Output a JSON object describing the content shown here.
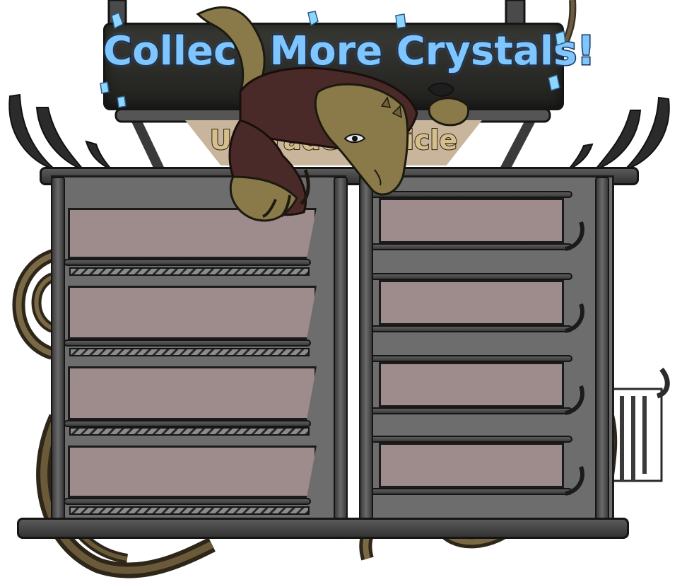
{
  "banner": {
    "title": "Collect More Crystals!",
    "subtitle": "Upgrade Vehicle"
  },
  "colors": {
    "title_fill": "#7fc6ff",
    "title_outline": "#0f2140",
    "banner_bg": "#2a2a27",
    "metal_dark": "#333333",
    "panel_grey": "#6d6d6d",
    "slot_mauve": "#9e8c8c",
    "subtitle_plate": "#c8b59c",
    "crystal": "#8fd6ff",
    "creature_skin": "#8a7a4a",
    "creature_jacket": "#4a2a28",
    "horn": "#2b2b2b"
  },
  "inventory": {
    "left_slots": [
      "",
      "",
      "",
      ""
    ],
    "right_slots": [
      "",
      "",
      "",
      ""
    ]
  },
  "decor": {
    "creature": "lizard-creature-icon",
    "crystals": "crystal-icon",
    "horns": "horn-icon",
    "cables": "cable-icon"
  }
}
